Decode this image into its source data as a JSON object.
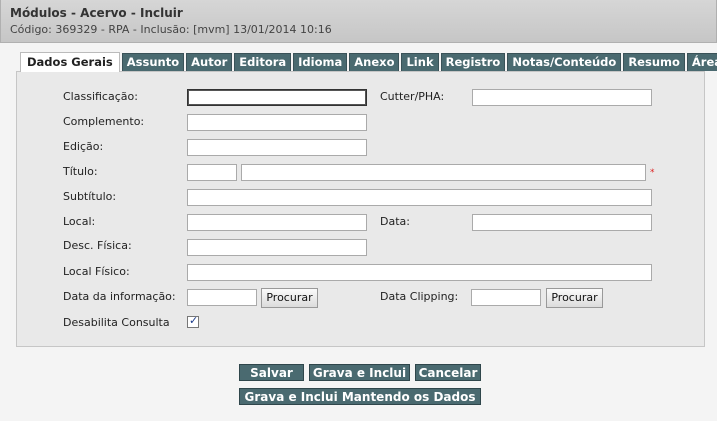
{
  "header": {
    "title": "Módulos - Acervo - Incluir",
    "subtitle": "Código: 369329 - RPA - Inclusão: [mvm] 13/01/2014 10:16"
  },
  "tabs": [
    {
      "label": "Dados Gerais",
      "active": true
    },
    {
      "label": "Assunto"
    },
    {
      "label": "Autor"
    },
    {
      "label": "Editora"
    },
    {
      "label": "Idioma"
    },
    {
      "label": "Anexo"
    },
    {
      "label": "Link"
    },
    {
      "label": "Registro"
    },
    {
      "label": "Notas/Conteúdo"
    },
    {
      "label": "Resumo"
    },
    {
      "label": "Área"
    }
  ],
  "form": {
    "classificacao": "Classificação:",
    "cutter": "Cutter/PHA:",
    "complemento": "Complemento:",
    "edicao": "Edição:",
    "titulo": "Título:",
    "titulo_required": "*",
    "subtitulo": "Subtítulo:",
    "local": "Local:",
    "data": "Data:",
    "desc_fisica": "Desc. Física:",
    "local_fisico": "Local Físico:",
    "data_informacao": "Data da informação:",
    "data_clipping": "Data Clipping:",
    "procurar": "Procurar",
    "desabilita_consulta": "Desabilita Consulta",
    "desabilita_checked": true
  },
  "actions": {
    "salvar": "Salvar",
    "grava_inclui": "Grava e Inclui",
    "cancelar": "Cancelar",
    "grava_inclui_mantendo": "Grava e Inclui Mantendo os Dados"
  },
  "colors": {
    "tab_bg": "#4a6a70",
    "button_bg": "#4a6a70",
    "required": "#dd2222"
  }
}
